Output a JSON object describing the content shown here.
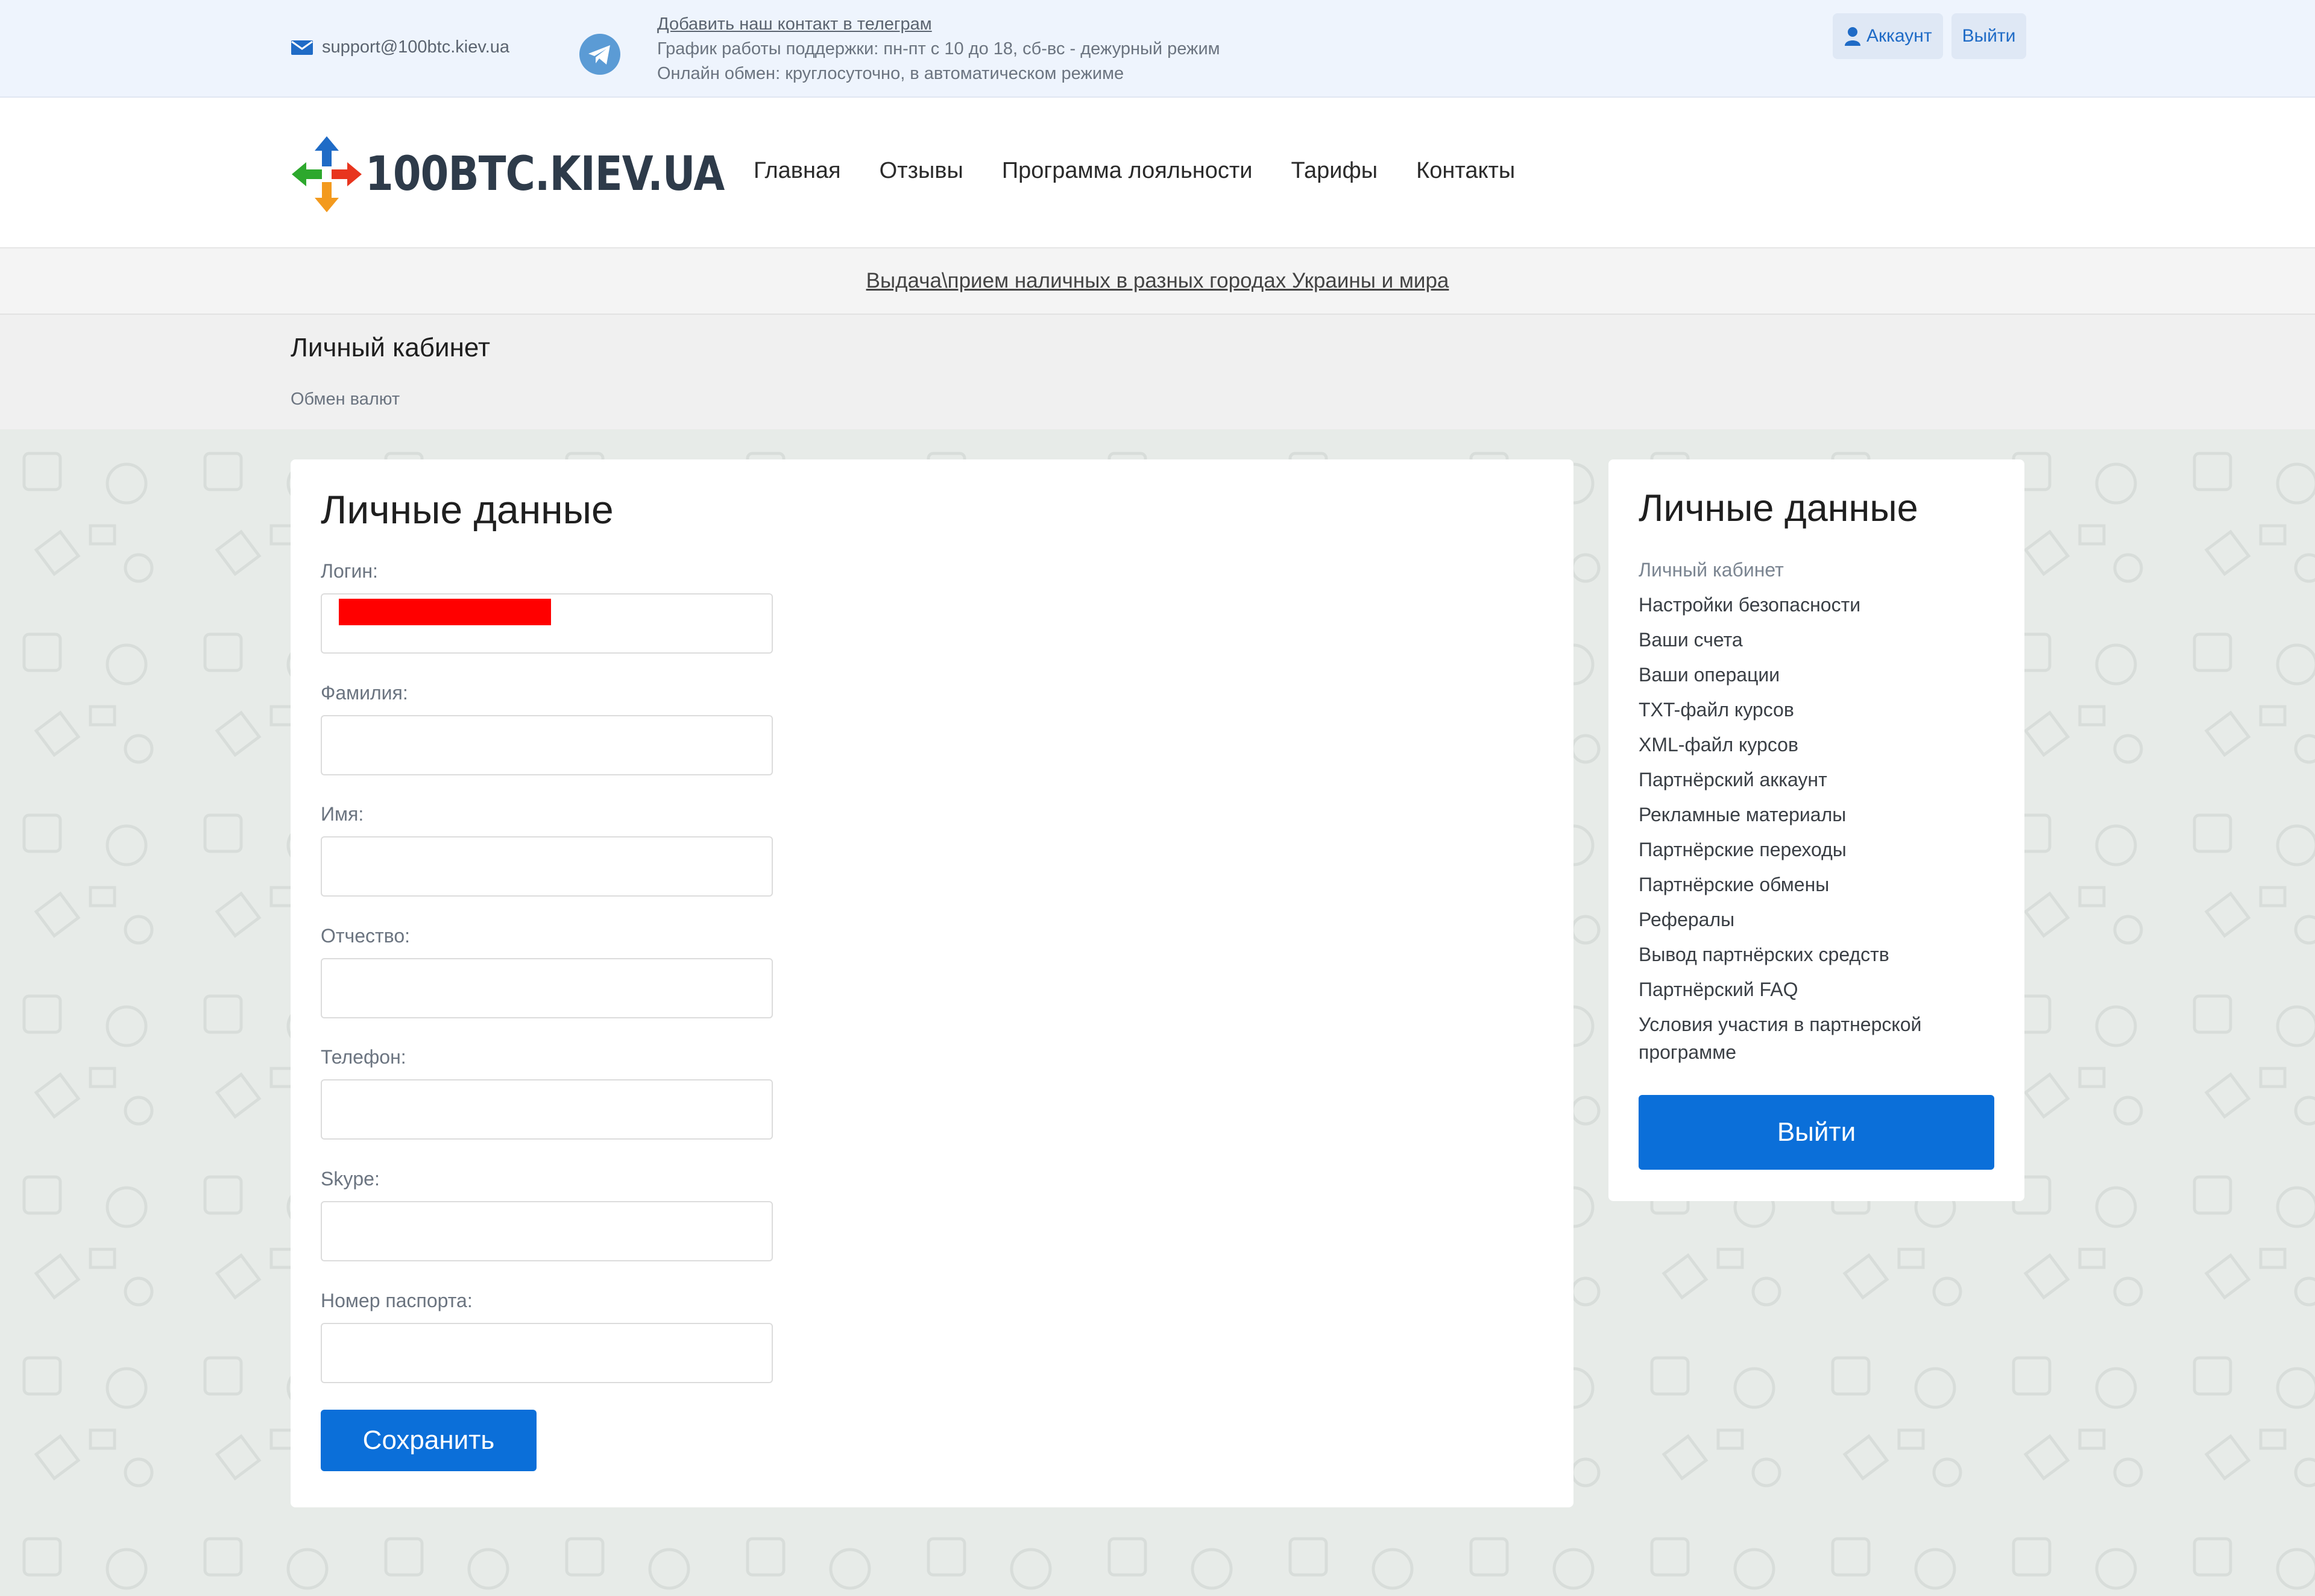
{
  "topbar": {
    "email": "support@100btc.kiev.ua",
    "telegram_link": "Добавить наш контакт в телеграм",
    "support_hours": "График работы поддержки: пн-пт с 10 до 18, сб-вс - дежурный режим",
    "online_exchange": "Онлайн обмен: круглосуточно, в автоматическом режиме",
    "account_label": "Аккаунт",
    "logout_label": "Выйти"
  },
  "header": {
    "logo_text": "100BTC.KIEV.UA",
    "nav": [
      "Главная",
      "Отзывы",
      "Программа лояльности",
      "Тарифы",
      "Контакты"
    ]
  },
  "notice": {
    "text": "Выдача\\прием наличных в разных городах Украины и мира"
  },
  "crumbs": {
    "page_title": "Личный кабинет",
    "breadcrumb": "Обмен валют"
  },
  "form": {
    "title": "Личные данные",
    "fields": [
      {
        "label": "Логин:",
        "value": ""
      },
      {
        "label": "Фамилия:",
        "value": ""
      },
      {
        "label": "Имя:",
        "value": ""
      },
      {
        "label": "Отчество:",
        "value": ""
      },
      {
        "label": "Телефон:",
        "value": ""
      },
      {
        "label": "Skype:",
        "value": ""
      },
      {
        "label": "Номер паспорта:",
        "value": ""
      }
    ],
    "save_label": "Сохранить"
  },
  "sidebar": {
    "title": "Личные данные",
    "items": [
      "Личный кабинет",
      "Настройки безопасности",
      "Ваши счета",
      "Ваши операции",
      "TXT-файл курсов",
      "XML-файл курсов",
      "Партнёрский аккаунт",
      "Рекламные материалы",
      "Партнёрские переходы",
      "Партнёрские обмены",
      "Рефералы",
      "Вывод партнёрских средств",
      "Партнёрский FAQ",
      "Условия участия в партнерской программе"
    ],
    "active_item": "Личный кабинет",
    "logout_label": "Выйти"
  },
  "colors": {
    "accent": "#0b6fd9",
    "topbar_bg": "#eef4fd",
    "page_bg": "#e7ebe8"
  },
  "icons": [
    "mail-icon",
    "telegram-icon",
    "user-icon",
    "logo-arrows-icon"
  ]
}
